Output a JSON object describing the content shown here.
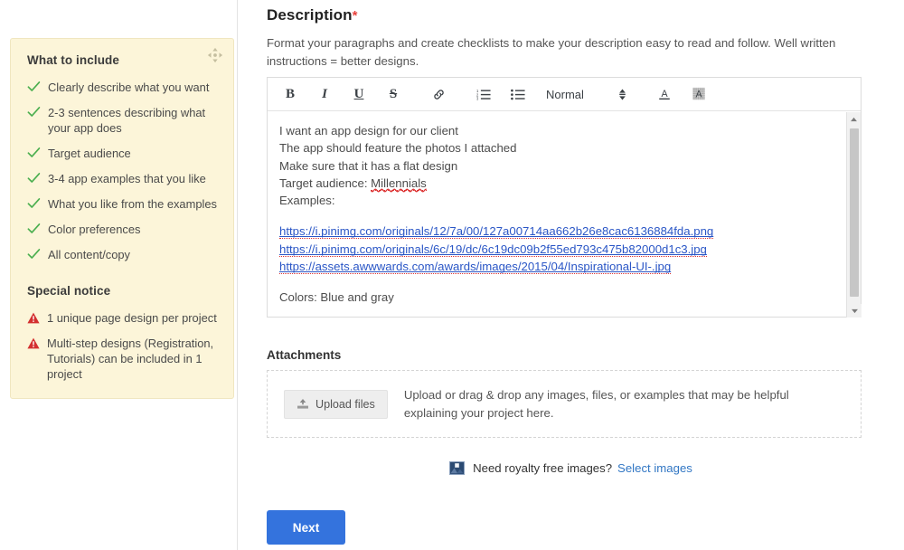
{
  "sidebar": {
    "drag_handle_icon": "move-handle-icon",
    "what_to_include": {
      "heading": "What to include",
      "items": [
        "Clearly describe what you want",
        "2-3 sentences describing what your app does",
        "Target audience",
        "3-4 app examples that you like",
        "What you like from the examples",
        "Color preferences",
        "All content/copy"
      ],
      "check_icon": "check-icon",
      "check_color": "#4caf50"
    },
    "special_notice": {
      "heading": "Special notice",
      "items": [
        "1 unique page design per project",
        "Multi-step designs (Registration, Tutorials) can be included in 1 project"
      ],
      "warning_icon": "warning-triangle-icon",
      "warning_color": "#d32f2f"
    },
    "panel_bg": "#fcf5d9"
  },
  "description": {
    "title": "Description",
    "required_marker": "*",
    "subtitle": "Format your paragraphs and create checklists to make your description easy to read and follow. Well written instructions = better designs."
  },
  "toolbar": {
    "bold": "B",
    "italic": "I",
    "underline": "U",
    "strikethrough": "S",
    "link_icon": "link-icon",
    "ordered_list_icon": "ordered-list-icon",
    "bullet_list_icon": "bullet-list-icon",
    "style_select_value": "Normal",
    "spinner_icon": "updown-arrows-icon",
    "text_color_icon": "text-color-icon",
    "highlight_color_icon": "highlight-color-icon"
  },
  "editor": {
    "lines": [
      "I want an app design for our client",
      "The app should feature the photos I attached",
      "Make sure that it has a flat design"
    ],
    "target_audience_label": "Target audience: ",
    "target_audience_value": "Millennials",
    "examples_label": "Examples:",
    "urls": [
      "https://i.pinimg.com/originals/12/7a/00/127a00714aa662b26e8cac6136884fda.png",
      "https://i.pinimg.com/originals/6c/19/dc/6c19dc09b2f55ed793c475b82000d1c3.jpg",
      "https://assets.awwwards.com/awards/images/2015/04/Inspirational-UI-.jpg"
    ],
    "colors_line": "Colors: Blue and gray",
    "link_color": "#2a56c6",
    "scrollbar": {
      "up_arrow_icon": "scroll-up-arrow-icon",
      "down_arrow_icon": "scroll-down-arrow-icon",
      "thumb_icon": "scrollbar-thumb"
    }
  },
  "attachments": {
    "title": "Attachments",
    "upload_button_label": "Upload files",
    "upload_icon": "upload-icon",
    "hint": "Upload or drag & drop any images, files, or examples that may be helpful explaining your project here."
  },
  "royalty": {
    "image_icon": "photo-icon",
    "question": "Need royalty free images?",
    "link_label": "Select images",
    "link_color": "#3277c4"
  },
  "footer": {
    "next_label": "Next",
    "next_color": "#3473dd"
  }
}
